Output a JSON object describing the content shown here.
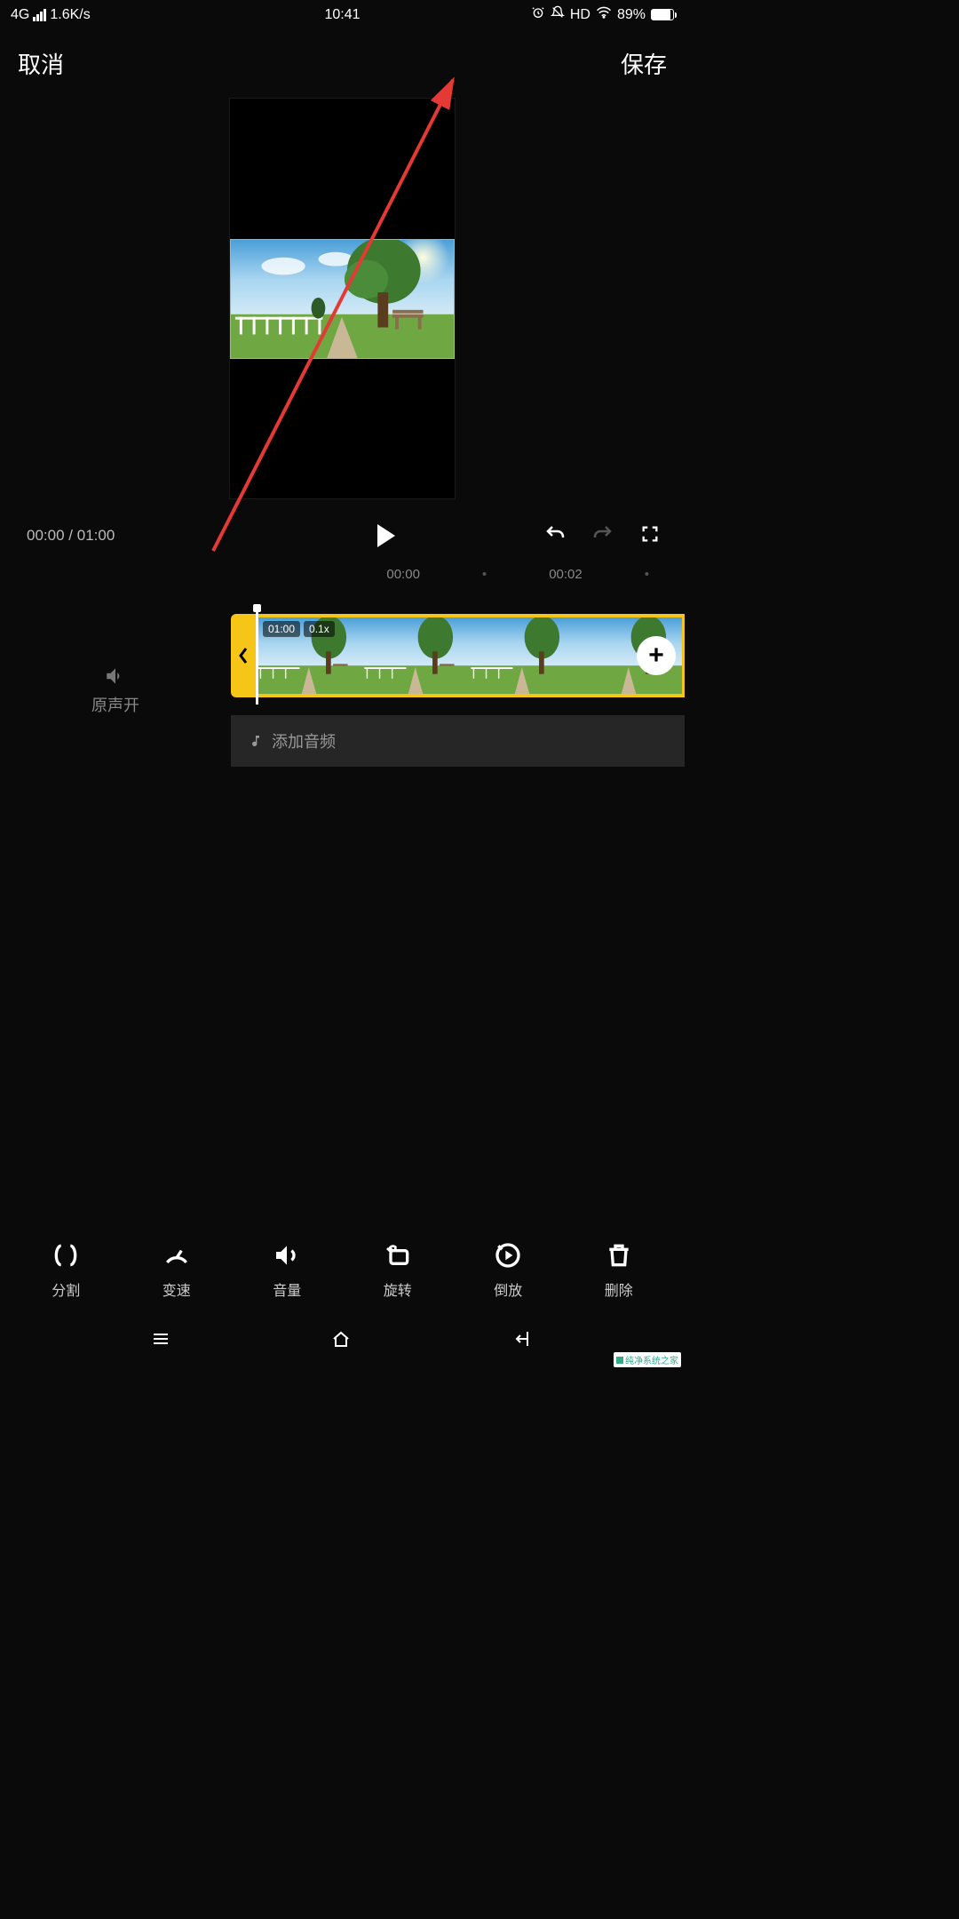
{
  "status": {
    "net": "4G",
    "speed": "1.6K/s",
    "time": "10:41",
    "hd": "HD",
    "battery_pct": "89%"
  },
  "header": {
    "cancel": "取消",
    "save": "保存"
  },
  "playback": {
    "cur": "00:00",
    "sep": "/",
    "total": "01:00"
  },
  "ruler": {
    "t1": "00:00",
    "t2": "00:02"
  },
  "sound": {
    "label": "原声开"
  },
  "clip": {
    "dur": "01:00",
    "speed": "0.1x"
  },
  "audio_add": "添加音频",
  "tools": {
    "split": "分割",
    "speed": "变速",
    "volume": "音量",
    "rotate": "旋转",
    "reverse": "倒放",
    "delete": "删除"
  },
  "watermark": "纯净系统之家"
}
